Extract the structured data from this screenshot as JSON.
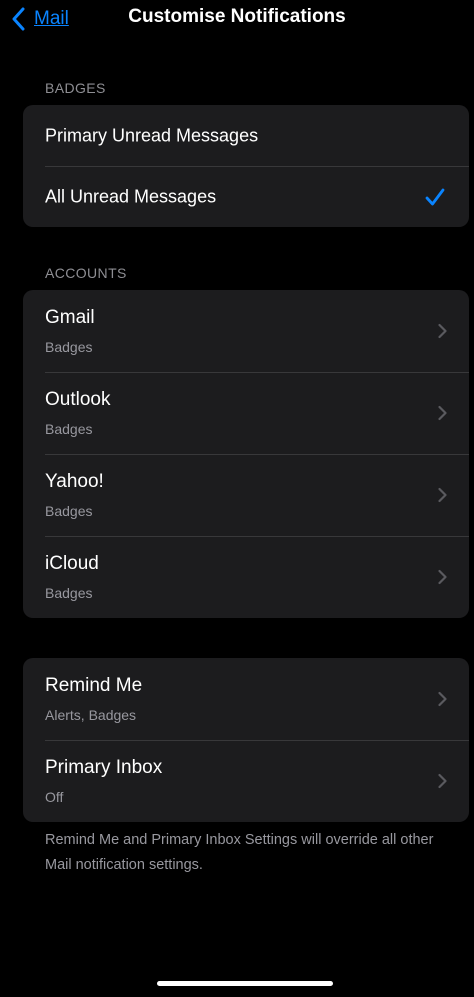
{
  "nav": {
    "back_label": "Mail",
    "title": "Customise Notifications"
  },
  "badges": {
    "header": "BADGES",
    "options": [
      {
        "label": "Primary Unread Messages",
        "selected": false
      },
      {
        "label": "All Unread Messages",
        "selected": true
      }
    ]
  },
  "accounts": {
    "header": "ACCOUNTS",
    "items": [
      {
        "title": "Gmail",
        "subtitle": "Badges"
      },
      {
        "title": "Outlook",
        "subtitle": "Badges"
      },
      {
        "title": "Yahoo!",
        "subtitle": "Badges"
      },
      {
        "title": "iCloud",
        "subtitle": "Badges"
      }
    ]
  },
  "special": {
    "items": [
      {
        "title": "Remind Me",
        "subtitle": "Alerts, Badges"
      },
      {
        "title": "Primary Inbox",
        "subtitle": "Off"
      }
    ],
    "footer": "Remind Me and Primary Inbox Settings will override all other Mail notification settings."
  },
  "colors": {
    "accent": "#0a84ff",
    "background": "#000000",
    "cell": "#1c1c1e",
    "secondary_text": "#98989f"
  },
  "icons": {
    "back": "chevron-left-icon",
    "selected": "checkmark-icon",
    "disclosure": "chevron-right-icon"
  }
}
